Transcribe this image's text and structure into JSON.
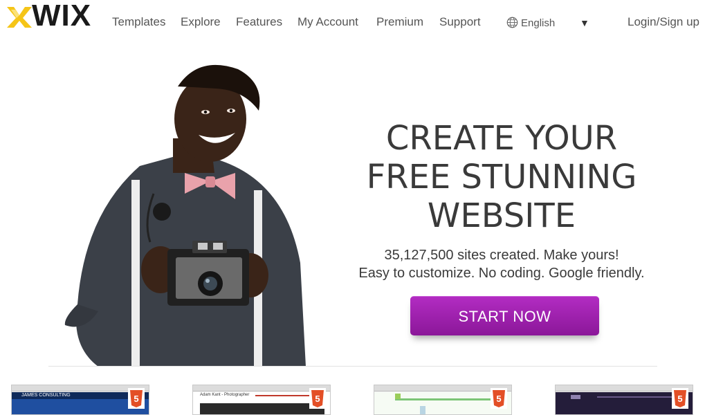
{
  "brand": {
    "logo_text": "WIX"
  },
  "nav": {
    "items": [
      {
        "label": "Templates"
      },
      {
        "label": "Explore"
      },
      {
        "label": "Features"
      },
      {
        "label": "My Account"
      },
      {
        "label": "Premium"
      },
      {
        "label": "Support"
      }
    ],
    "language": "English",
    "login": "Login/Sign up"
  },
  "hero": {
    "headline_line1": "CREATE YOUR",
    "headline_line2": "FREE STUNNING",
    "headline_line3": "WEBSITE",
    "sites_created": "35,127,500 sites created. Make yours!",
    "tagline": "Easy to customize. No coding. Google friendly.",
    "cta": "START NOW"
  },
  "thumbnails": [
    {
      "name": "James Consulting",
      "label": "JAMES CONSULTING",
      "theme": "#1f4fa0"
    },
    {
      "name": "Adam Kant - Photographer",
      "label": "Adam Kant - Photographer",
      "theme": "#ffffff"
    },
    {
      "name": "Green landing site",
      "label": "",
      "theme": "#eaf6ea"
    },
    {
      "name": "Dark purple site",
      "label": "",
      "theme": "#241d3a"
    }
  ],
  "colors": {
    "cta": "#9b21ab",
    "text": "#3a3a3a",
    "logo_yellow": "#f5c518"
  }
}
